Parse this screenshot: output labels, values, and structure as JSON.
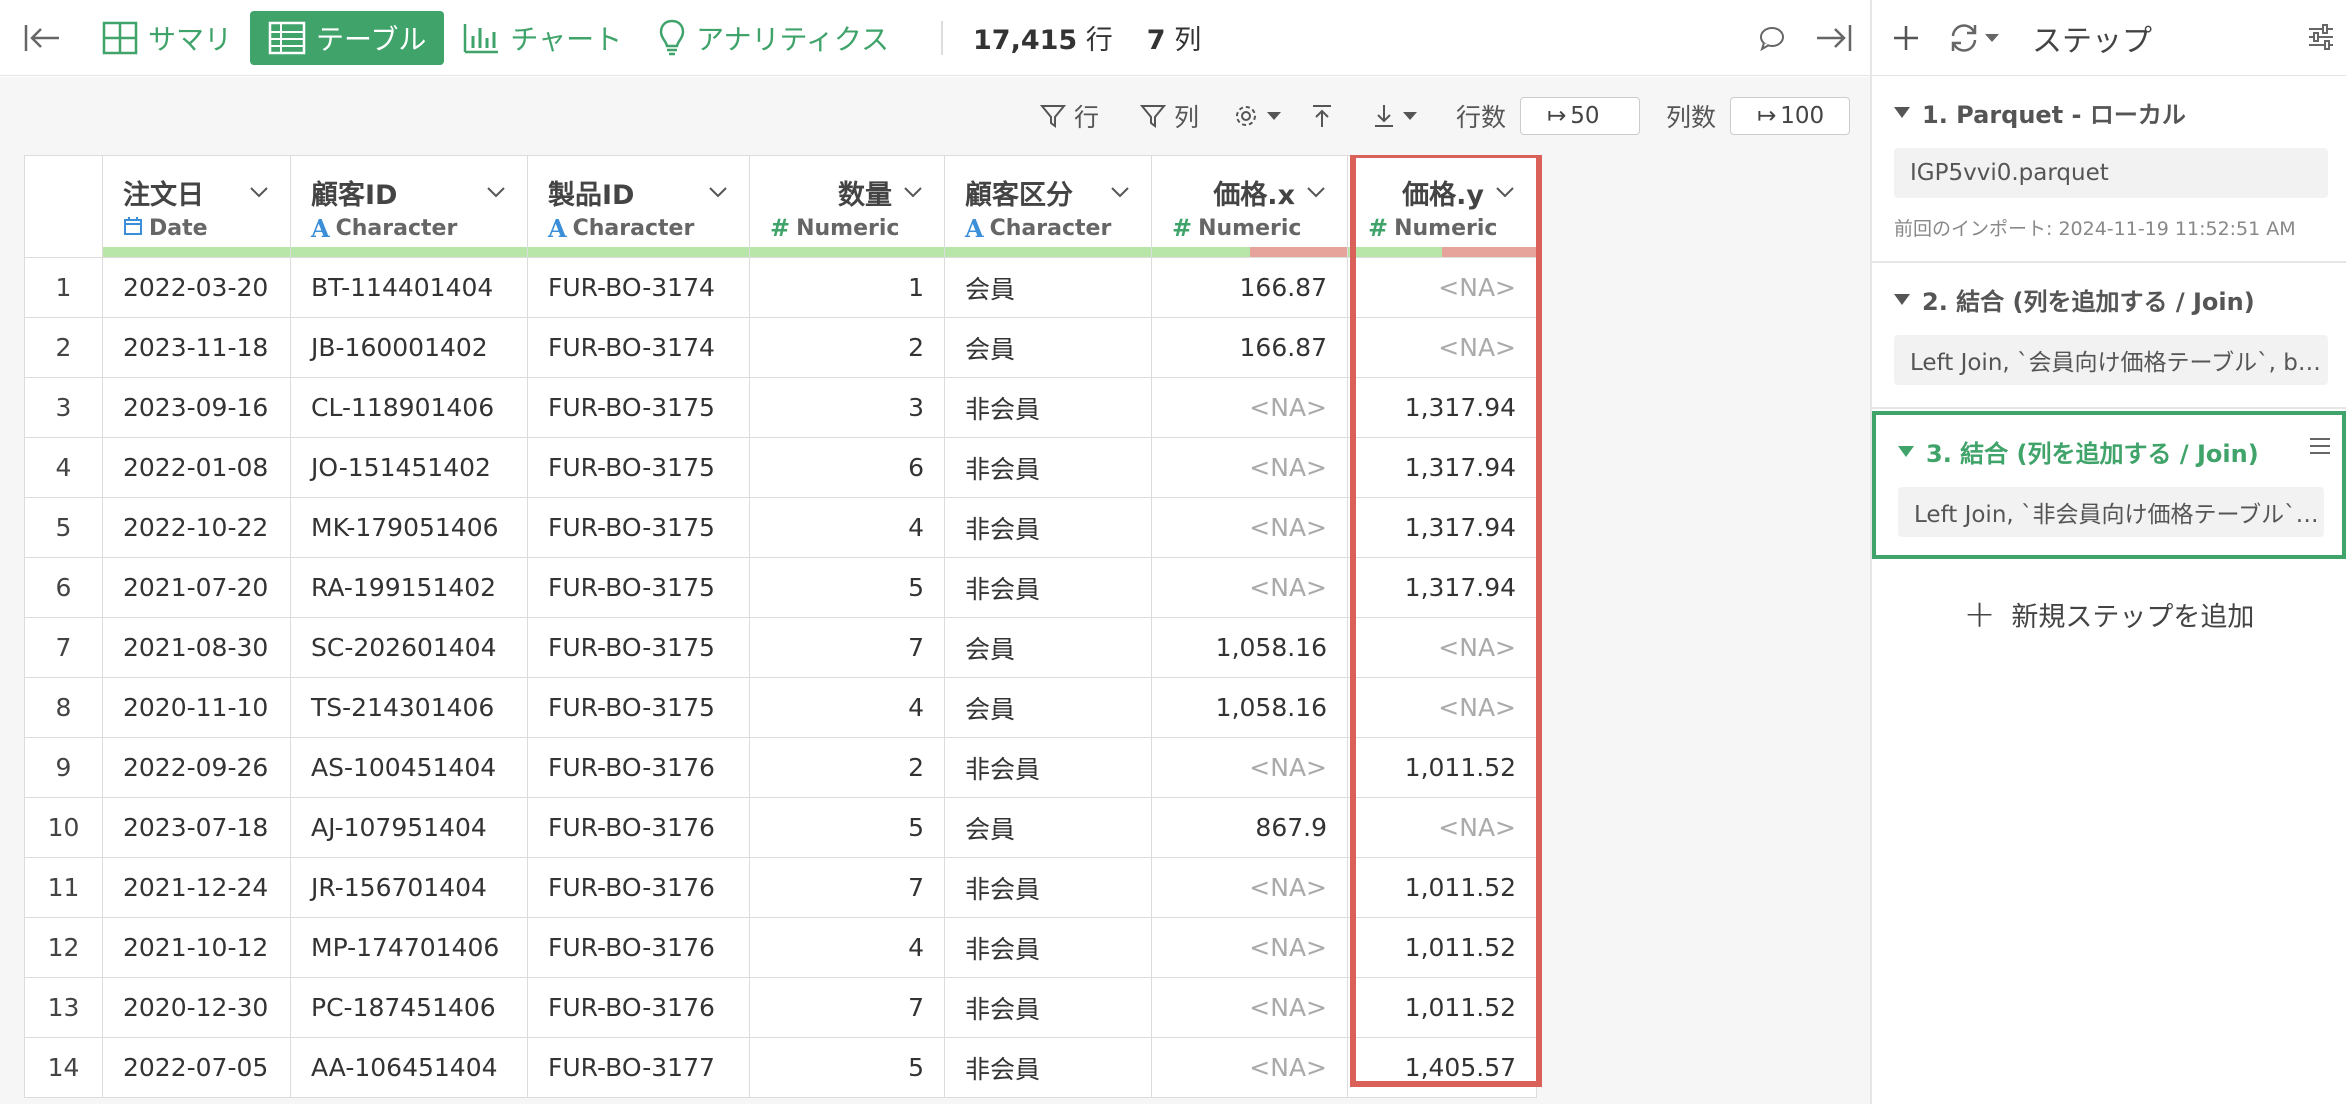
{
  "toolbar": {
    "tabs": [
      {
        "label": "サマリ",
        "icon": "summary-grid-icon"
      },
      {
        "label": "テーブル",
        "icon": "table-icon",
        "active": true
      },
      {
        "label": "チャート",
        "icon": "bar-chart-icon"
      },
      {
        "label": "アナリティクス",
        "icon": "lightbulb-icon"
      }
    ],
    "rows_count": "17,415",
    "rows_unit": "行",
    "cols_count": "7",
    "cols_unit": "列"
  },
  "subbar": {
    "filter_rows": "行",
    "filter_cols": "列",
    "rows_label": "行数",
    "rows_value": "50",
    "cols_label": "列数",
    "cols_value": "100"
  },
  "columns": [
    {
      "name": "注文日",
      "type": "Date",
      "type_icon": "calendar-icon",
      "align": "left",
      "missing": 0
    },
    {
      "name": "顧客ID",
      "type": "Character",
      "type_icon": "A",
      "align": "left",
      "missing": 0
    },
    {
      "name": "製品ID",
      "type": "Character",
      "type_icon": "A",
      "align": "left",
      "missing": 0
    },
    {
      "name": "数量",
      "type": "Numeric",
      "type_icon": "#",
      "align": "right",
      "missing": 0
    },
    {
      "name": "顧客区分",
      "type": "Character",
      "type_icon": "A",
      "align": "left",
      "missing": 0
    },
    {
      "name": "価格.x",
      "type": "Numeric",
      "type_icon": "#",
      "align": "right",
      "missing": 0.5
    },
    {
      "name": "価格.y",
      "type": "Numeric",
      "type_icon": "#",
      "align": "right",
      "missing": 0.5
    }
  ],
  "rows": [
    [
      "1",
      "2022-03-20",
      "BT-114401404",
      "FUR-BO-3174",
      "1",
      "会員",
      "166.87",
      "<NA>"
    ],
    [
      "2",
      "2023-11-18",
      "JB-160001402",
      "FUR-BO-3174",
      "2",
      "会員",
      "166.87",
      "<NA>"
    ],
    [
      "3",
      "2023-09-16",
      "CL-118901406",
      "FUR-BO-3175",
      "3",
      "非会員",
      "<NA>",
      "1,317.94"
    ],
    [
      "4",
      "2022-01-08",
      "JO-151451402",
      "FUR-BO-3175",
      "6",
      "非会員",
      "<NA>",
      "1,317.94"
    ],
    [
      "5",
      "2022-10-22",
      "MK-179051406",
      "FUR-BO-3175",
      "4",
      "非会員",
      "<NA>",
      "1,317.94"
    ],
    [
      "6",
      "2021-07-20",
      "RA-199151402",
      "FUR-BO-3175",
      "5",
      "非会員",
      "<NA>",
      "1,317.94"
    ],
    [
      "7",
      "2021-08-30",
      "SC-202601404",
      "FUR-BO-3175",
      "7",
      "会員",
      "1,058.16",
      "<NA>"
    ],
    [
      "8",
      "2020-11-10",
      "TS-214301406",
      "FUR-BO-3175",
      "4",
      "会員",
      "1,058.16",
      "<NA>"
    ],
    [
      "9",
      "2022-09-26",
      "AS-100451404",
      "FUR-BO-3176",
      "2",
      "非会員",
      "<NA>",
      "1,011.52"
    ],
    [
      "10",
      "2023-07-18",
      "AJ-107951404",
      "FUR-BO-3176",
      "5",
      "会員",
      "867.9",
      "<NA>"
    ],
    [
      "11",
      "2021-12-24",
      "JR-156701404",
      "FUR-BO-3176",
      "7",
      "非会員",
      "<NA>",
      "1,011.52"
    ],
    [
      "12",
      "2021-10-12",
      "MP-174701406",
      "FUR-BO-3176",
      "4",
      "非会員",
      "<NA>",
      "1,011.52"
    ],
    [
      "13",
      "2020-12-30",
      "PC-187451406",
      "FUR-BO-3176",
      "7",
      "非会員",
      "<NA>",
      "1,011.52"
    ],
    [
      "14",
      "2022-07-05",
      "AA-106451404",
      "FUR-BO-3177",
      "5",
      "非会員",
      "<NA>",
      "1,405.57"
    ]
  ],
  "sidebar": {
    "title": "ステップ",
    "steps": [
      {
        "title": "1. Parquet - ローカル",
        "detail": "IGP5vvi0.parquet",
        "meta": "前回のインポート: 2024-11-19 11:52:51 AM"
      },
      {
        "title": "2. 結合 (列を追加する / Join)",
        "detail": "Left Join, `会員向け価格テーブル`, b…"
      },
      {
        "title": "3. 結合 (列を追加する / Join)",
        "detail": "Left Join, `非会員向け価格テーブル`…",
        "active": true
      }
    ],
    "add_step": "新規ステップを追加"
  },
  "colors": {
    "accent": "#3fa36a",
    "highlight": "#d9615a",
    "valid": "#b8e6a8",
    "missing": "#e6a39c"
  }
}
